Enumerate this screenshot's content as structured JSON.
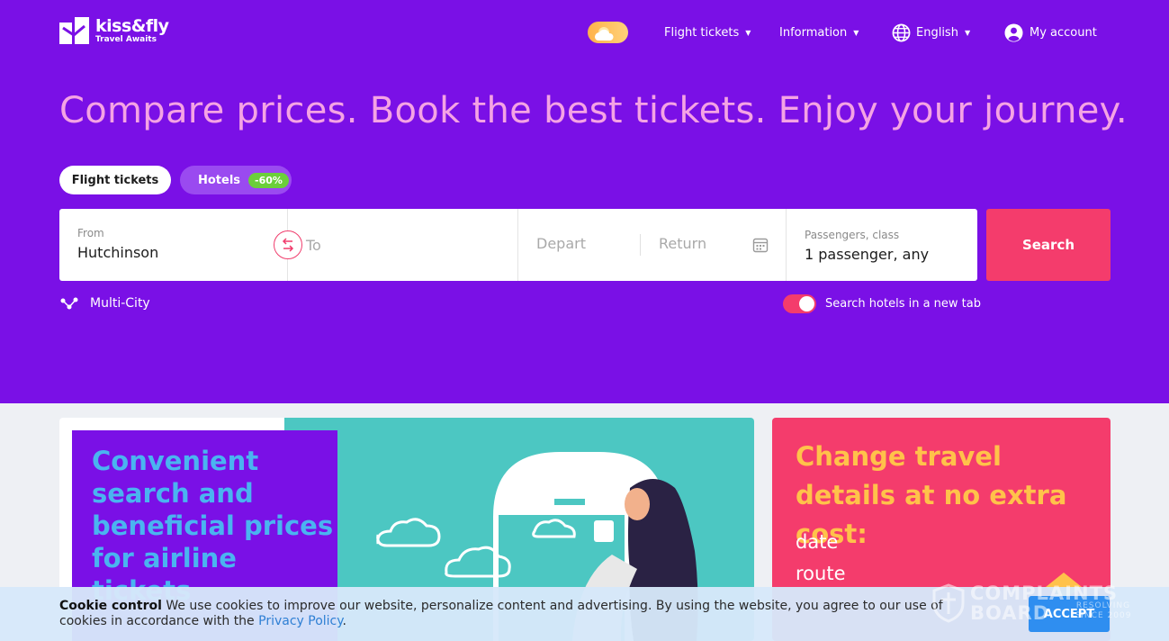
{
  "brand": {
    "name": "kiss&fly",
    "tagline": "Travel Awaits"
  },
  "nav": {
    "flight_tickets": "Flight tickets",
    "information": "Information",
    "language": "English",
    "account": "My account"
  },
  "hero": {
    "headline": "Compare prices. Book the best tickets. Enjoy your journey."
  },
  "tabs": {
    "flights": "Flight tickets",
    "hotels": "Hotels",
    "hotels_badge": "-60%"
  },
  "search": {
    "from_label": "From",
    "from_value": "Hutchinson",
    "to_placeholder": "To",
    "depart_placeholder": "Depart",
    "return_placeholder": "Return",
    "passengers_label": "Passengers, class",
    "passengers_value": "1 passenger, any",
    "search_button": "Search",
    "multicity": "Multi-City",
    "hotels_new_tab": "Search hotels in a new tab"
  },
  "promo_left": {
    "text": "Convenient search and beneficial prices for airline tickets"
  },
  "promo_right": {
    "title": "Change travel details at no extra cost:",
    "items": [
      "date",
      "route"
    ]
  },
  "cookie": {
    "title": "Cookie control",
    "text": "We use cookies to improve our website, personalize content and advertising. By using the website, you agree to our use of cookies in accordance with the",
    "link": "Privacy Policy",
    "period": ".",
    "accept": "ACCEPT"
  },
  "watermark": {
    "line1": "COMPLAINTS",
    "line2": "BOARD",
    "small1": "RESOLVING",
    "small2": "SINCE 2009"
  },
  "colors": {
    "hero": "#7a10e6",
    "accent": "#f43c6c",
    "headline": "#f5a3e4",
    "promo_teal": "#4cc7c2",
    "promo_gold": "#ffc24a"
  }
}
